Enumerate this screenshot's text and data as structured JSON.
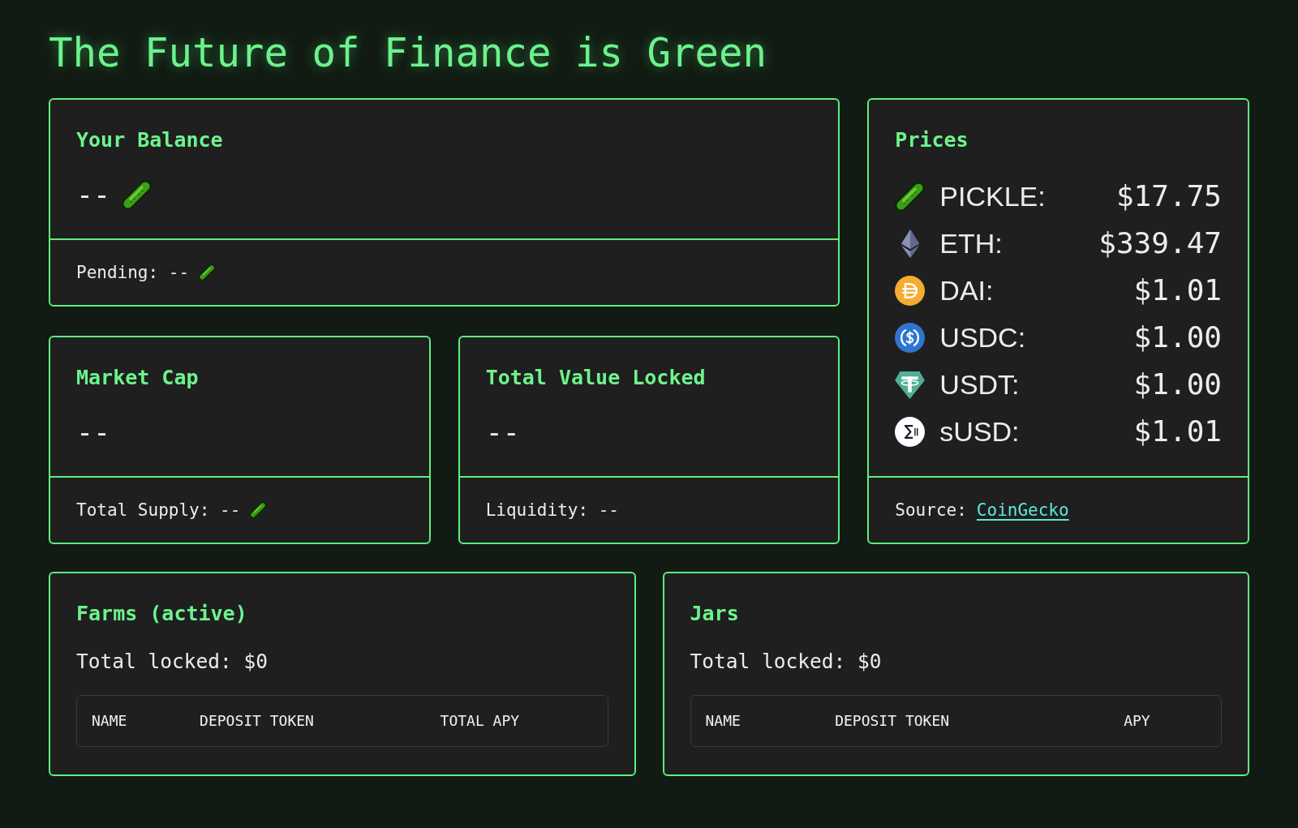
{
  "title": "The Future of Finance is Green",
  "balance": {
    "heading": "Your Balance",
    "value": "--",
    "pending": "Pending: --"
  },
  "market_cap": {
    "heading": "Market Cap",
    "value": "--",
    "total_supply": "Total Supply: --"
  },
  "total_value_locked": {
    "heading": "Total Value Locked",
    "value": "--",
    "liquidity": "Liquidity: --"
  },
  "prices": {
    "heading": "Prices",
    "items": [
      {
        "token": "PICKLE:",
        "price": "$17.75"
      },
      {
        "token": "ETH:",
        "price": "$339.47"
      },
      {
        "token": "DAI:",
        "price": "$1.01"
      },
      {
        "token": "USDC:",
        "price": "$1.00"
      },
      {
        "token": "USDT:",
        "price": "$1.00"
      },
      {
        "token": "sUSD:",
        "price": "$1.01"
      }
    ],
    "source": {
      "label": "Source:",
      "link": "CoinGecko"
    }
  },
  "farms": {
    "heading": "Farms (active)",
    "total_locked": "Total locked: $0",
    "columns": [
      "NAME",
      "DEPOSIT TOKEN",
      "TOTAL APY"
    ]
  },
  "jars": {
    "heading": "Jars",
    "total_locked": "Total locked: $0",
    "columns": [
      "NAME",
      "DEPOSIT TOKEN",
      "APY"
    ]
  }
}
